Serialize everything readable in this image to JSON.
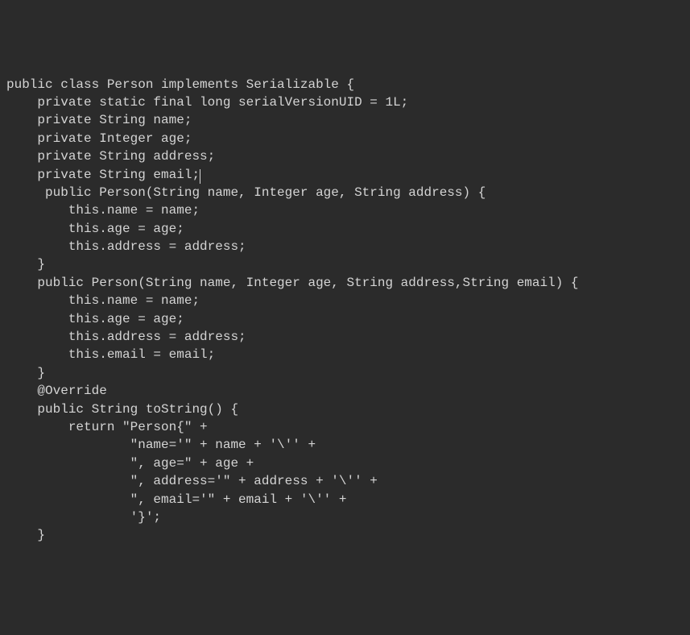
{
  "code": {
    "line1": "public class Person implements Serializable {",
    "line2": "    private static final long serialVersionUID = 1L;",
    "line3": "    private String name;",
    "line4": "    private Integer age;",
    "line5": "    private String address;",
    "line6": "    private String email;",
    "line7": "     public Person(String name, Integer age, String address) {",
    "line8": "        this.name = name;",
    "line9": "        this.age = age;",
    "line10": "        this.address = address;",
    "line11": "    }",
    "line12": "    public Person(String name, Integer age, String address,String email) {",
    "line13": "        this.name = name;",
    "line14": "        this.age = age;",
    "line15": "        this.address = address;",
    "line16": "        this.email = email;",
    "line17": "    }",
    "line18": "    @Override",
    "line19": "    public String toString() {",
    "line20": "        return \"Person{\" +",
    "line21": "                \"name='\" + name + '\\'' +",
    "line22": "                \", age=\" + age +",
    "line23": "                \", address='\" + address + '\\'' +",
    "line24": "                \", email='\" + email + '\\'' +",
    "line25": "                '}';",
    "line26": "    }"
  }
}
